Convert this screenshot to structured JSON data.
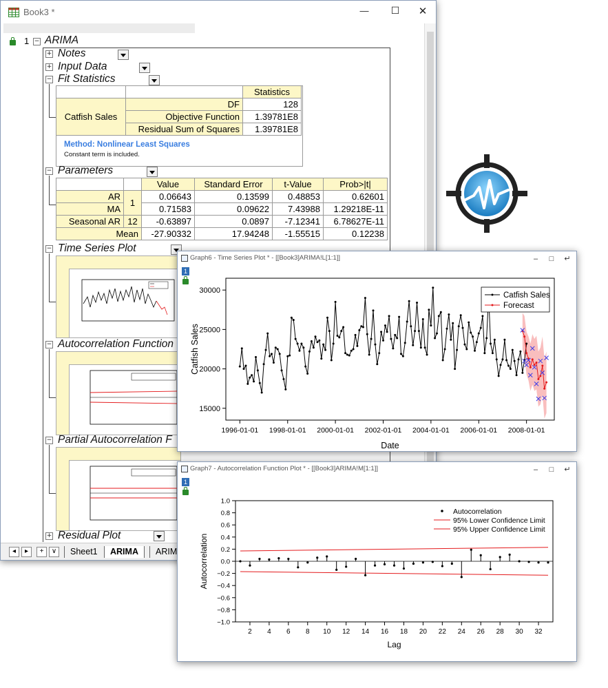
{
  "book": {
    "title": "Book3 *",
    "row_number": "1",
    "root_label": "ARIMA",
    "buttons": {
      "minimize": "—",
      "maximize": "☐",
      "close": "✕"
    },
    "sections": {
      "notes": "Notes",
      "input_data": "Input Data",
      "fit_statistics": "Fit Statistics",
      "parameters": "Parameters",
      "ts_plot": "Time Series Plot",
      "acf": "Autocorrelation Function",
      "pacf": "Partial Autocorrelation F",
      "residual": "Residual Plot"
    },
    "fit_stats": {
      "header": "Statistics",
      "row_label": "Catfish Sales",
      "rows": [
        {
          "label": "DF",
          "value": "128"
        },
        {
          "label": "Objective Function",
          "value": "1.39781E8"
        },
        {
          "label": "Residual Sum of Squares",
          "value": "1.39781E8"
        }
      ],
      "method": "Method: Nonlinear Least Squares",
      "note": "Constant term is included."
    },
    "params": {
      "headers": [
        "Value",
        "Standard Error",
        "t-Value",
        "Prob>|t|"
      ],
      "rows": [
        {
          "name": "AR",
          "lag": "1",
          "v": "0.06643",
          "se": "0.13599",
          "t": "0.48853",
          "p": "0.62601"
        },
        {
          "name": "MA",
          "lag": "",
          "v": "0.71583",
          "se": "0.09622",
          "t": "7.43988",
          "p": "1.29218E-11"
        },
        {
          "name": "Seasonal AR",
          "lag": "12",
          "v": "-0.63897",
          "se": "0.0897",
          "t": "-7.12341",
          "p": "6.78627E-11"
        },
        {
          "name": "Mean",
          "lag": "",
          "v": "-27.90332",
          "se": "17.94248",
          "t": "-1.55515",
          "p": "0.12238"
        }
      ]
    },
    "tabs": {
      "sheet1": "Sheet1",
      "arima": "ARIMA",
      "arima2": "ARIM"
    },
    "nav": {
      "first": "◂",
      "next": "▸",
      "add": "+",
      "more": "∨"
    }
  },
  "graph6": {
    "title": "Graph6 - Time Series Plot * - [[Book3]ARIMA!L[1:1]]",
    "layer": "1",
    "buttons": {
      "minimize": "–",
      "maximize": "□",
      "restore": "↵"
    }
  },
  "graph7": {
    "title": "Graph7 - Autocorrelation Function Plot * - [[Book3]ARIMA!M[1:1]]",
    "layer": "1",
    "buttons": {
      "minimize": "–",
      "maximize": "□",
      "restore": "↵"
    }
  },
  "chart_data": [
    {
      "type": "line",
      "xlabel": "Date",
      "ylabel": "Catfish Sales",
      "xlim": [
        "1995-06-01",
        "2009-03-01"
      ],
      "ylim": [
        13500,
        31500
      ],
      "xticks": [
        "1996-01-01",
        "1998-01-01",
        "2000-01-01",
        "2002-01-01",
        "2004-01-01",
        "2006-01-01",
        "2008-01-01"
      ],
      "yticks": [
        15000,
        20000,
        25000,
        30000
      ],
      "legend_position": "top-right",
      "series": [
        {
          "name": "Catfish Sales",
          "color": "#000000",
          "start": "1996-01-01",
          "step_months": 1,
          "values": [
            20300,
            22600,
            20000,
            20400,
            18100,
            18900,
            19200,
            18400,
            21500,
            19800,
            18200,
            17000,
            20600,
            22400,
            24500,
            21600,
            21900,
            20800,
            22700,
            22500,
            21900,
            19800,
            18700,
            17400,
            21600,
            21700,
            26500,
            26200,
            23800,
            23200,
            22300,
            23200,
            22700,
            20300,
            19400,
            22200,
            23500,
            22700,
            24100,
            23400,
            23600,
            21300,
            23100,
            22400,
            26500,
            24800,
            21100,
            23200,
            28500,
            24200,
            24000,
            24800,
            25300,
            22000,
            21800,
            21700,
            22300,
            22500,
            24300,
            22900,
            24900,
            25400,
            25300,
            29000,
            24400,
            21800,
            23800,
            27400,
            23100,
            20600,
            22000,
            24700,
            23600,
            25500,
            24700,
            26700,
            23800,
            22600,
            24300,
            23900,
            26600,
            21900,
            21600,
            23300,
            26000,
            28600,
            25400,
            23000,
            24800,
            28400,
            24800,
            22700,
            26300,
            22700,
            21800,
            27500,
            25500,
            30300,
            23900,
            24500,
            26700,
            27200,
            21100,
            22500,
            25100,
            26900,
            23700,
            25800,
            20000,
            22400,
            25400,
            26800,
            25200,
            23100,
            22500,
            25900,
            24600,
            24100,
            22300,
            23400,
            24500,
            25200,
            26700,
            22000,
            23900,
            29400,
            23200,
            22000,
            23700,
            21200,
            19100,
            20500,
            21200,
            23700,
            21100,
            20400,
            20000,
            22400,
            21000,
            19200,
            21200,
            22200,
            19500,
            21100,
            23200
          ]
        },
        {
          "name": "Forecast",
          "color": "#e41a1c",
          "band_color": "#f7a8a8",
          "start": "2007-11-01",
          "step_months": 1,
          "values": [
            24800,
            24100,
            22000,
            21300,
            20200,
            21200,
            20500,
            20800,
            18700,
            19100,
            20400,
            17500,
            18300
          ],
          "lower": [
            22500,
            21500,
            19300,
            18500,
            17200,
            18000,
            17200,
            17400,
            15200,
            15500,
            16700,
            13700,
            14400
          ],
          "upper": [
            27100,
            26700,
            24700,
            24100,
            23200,
            24400,
            23800,
            24200,
            22200,
            22700,
            24100,
            21300,
            22200
          ]
        }
      ]
    },
    {
      "type": "scatter",
      "xlabel": "Lag",
      "ylabel": "Autocorrelation",
      "xlim": [
        0.5,
        33.5
      ],
      "ylim": [
        -1.0,
        1.0
      ],
      "xticks": [
        2,
        4,
        6,
        8,
        10,
        12,
        14,
        16,
        18,
        20,
        22,
        24,
        26,
        28,
        30,
        32
      ],
      "yticks": [
        -1.0,
        -0.8,
        -0.6,
        -0.4,
        -0.2,
        0.0,
        0.2,
        0.4,
        0.6,
        0.8,
        1.0
      ],
      "legend_position": "top-right",
      "series": [
        {
          "name": "Autocorrelation",
          "color": "#000000",
          "x": [
            1,
            2,
            3,
            4,
            5,
            6,
            7,
            8,
            9,
            10,
            11,
            12,
            13,
            14,
            15,
            16,
            17,
            18,
            19,
            20,
            21,
            22,
            23,
            24,
            25,
            26,
            27,
            28,
            29,
            30,
            31,
            32,
            33
          ],
          "values": [
            0.0,
            -0.07,
            0.04,
            0.03,
            0.05,
            0.04,
            -0.1,
            -0.02,
            0.06,
            0.08,
            -0.14,
            -0.09,
            0.04,
            -0.23,
            -0.07,
            -0.05,
            -0.07,
            -0.12,
            -0.04,
            -0.02,
            -0.01,
            -0.08,
            -0.04,
            -0.26,
            0.19,
            0.1,
            -0.13,
            0.07,
            0.11,
            0.0,
            -0.01,
            -0.02,
            -0.02
          ]
        },
        {
          "name": "95% Lower Confidence Limit",
          "color": "#e41a1c",
          "x": [
            1,
            33
          ],
          "values": [
            -0.17,
            -0.23
          ]
        },
        {
          "name": "95% Upper Confidence Limit",
          "color": "#e41a1c",
          "x": [
            1,
            33
          ],
          "values": [
            0.17,
            0.23
          ]
        }
      ]
    }
  ]
}
